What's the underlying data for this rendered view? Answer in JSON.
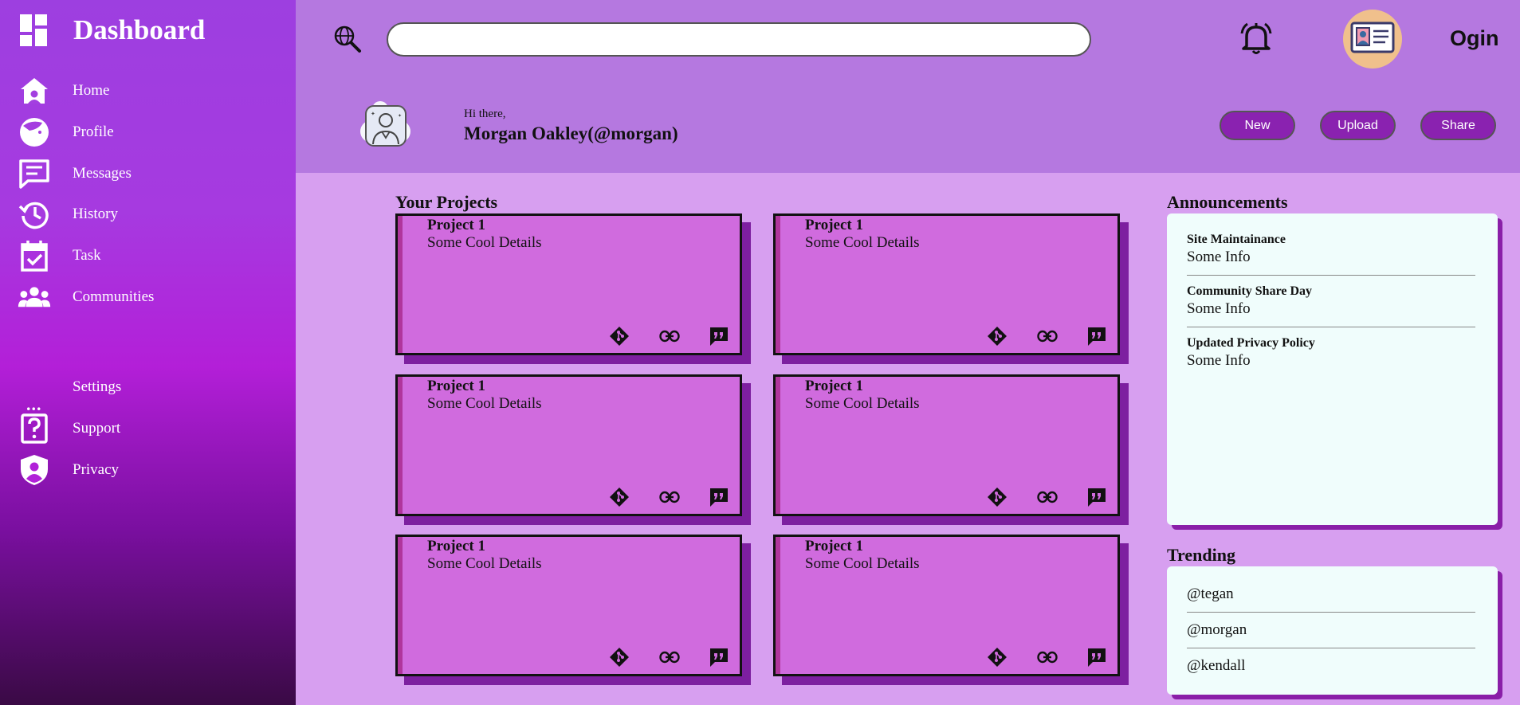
{
  "sidebar": {
    "title": "Dashboard",
    "items": [
      {
        "label": "Home",
        "icon": "home-icon"
      },
      {
        "label": "Profile",
        "icon": "profile-icon"
      },
      {
        "label": "Messages",
        "icon": "messages-icon"
      },
      {
        "label": "History",
        "icon": "history-icon"
      },
      {
        "label": "Task",
        "icon": "task-icon"
      },
      {
        "label": "Communities",
        "icon": "communities-icon"
      }
    ],
    "bottom_items": [
      {
        "label": "Settings",
        "icon": "more-dots-icon"
      },
      {
        "label": "Support",
        "icon": "help-icon"
      },
      {
        "label": "Privacy",
        "icon": "shield-user-icon"
      }
    ],
    "dots": "..."
  },
  "header": {
    "search_placeholder": "",
    "login_label": "Ogin",
    "greeting": "Hi there,",
    "username": "Morgan Oakley(@morgan)",
    "buttons": {
      "new": "New",
      "upload": "Upload",
      "share": "Share"
    }
  },
  "projects": {
    "title": "Your Projects",
    "items": [
      {
        "title": "Project 1",
        "details": "Some Cool Details"
      },
      {
        "title": "Project 1",
        "details": "Some Cool Details"
      },
      {
        "title": "Project 1",
        "details": "Some Cool Details"
      },
      {
        "title": "Project 1",
        "details": "Some Cool Details"
      },
      {
        "title": "Project 1",
        "details": "Some Cool Details"
      },
      {
        "title": "Project 1",
        "details": "Some Cool Details"
      }
    ]
  },
  "announcements": {
    "title": "Announcements",
    "items": [
      {
        "title": "Site Maintainance",
        "info": "Some Info"
      },
      {
        "title": "Community Share Day",
        "info": "Some Info"
      },
      {
        "title": "Updated Privacy Policy",
        "info": "Some Info"
      }
    ]
  },
  "trending": {
    "title": "Trending",
    "items": [
      "@tegan",
      "@morgan",
      "@kendall"
    ]
  },
  "colors": {
    "sidebar_top": "#9d3fe0",
    "sidebar_bottom": "#3a0a45",
    "header_bg": "#b578e0",
    "main_bg": "#d79ff0",
    "card_bg": "#d06bde",
    "card_shadow": "#7d1fa0",
    "button_bg": "#8a22b0",
    "panel_bg": "#f0fdfc"
  }
}
